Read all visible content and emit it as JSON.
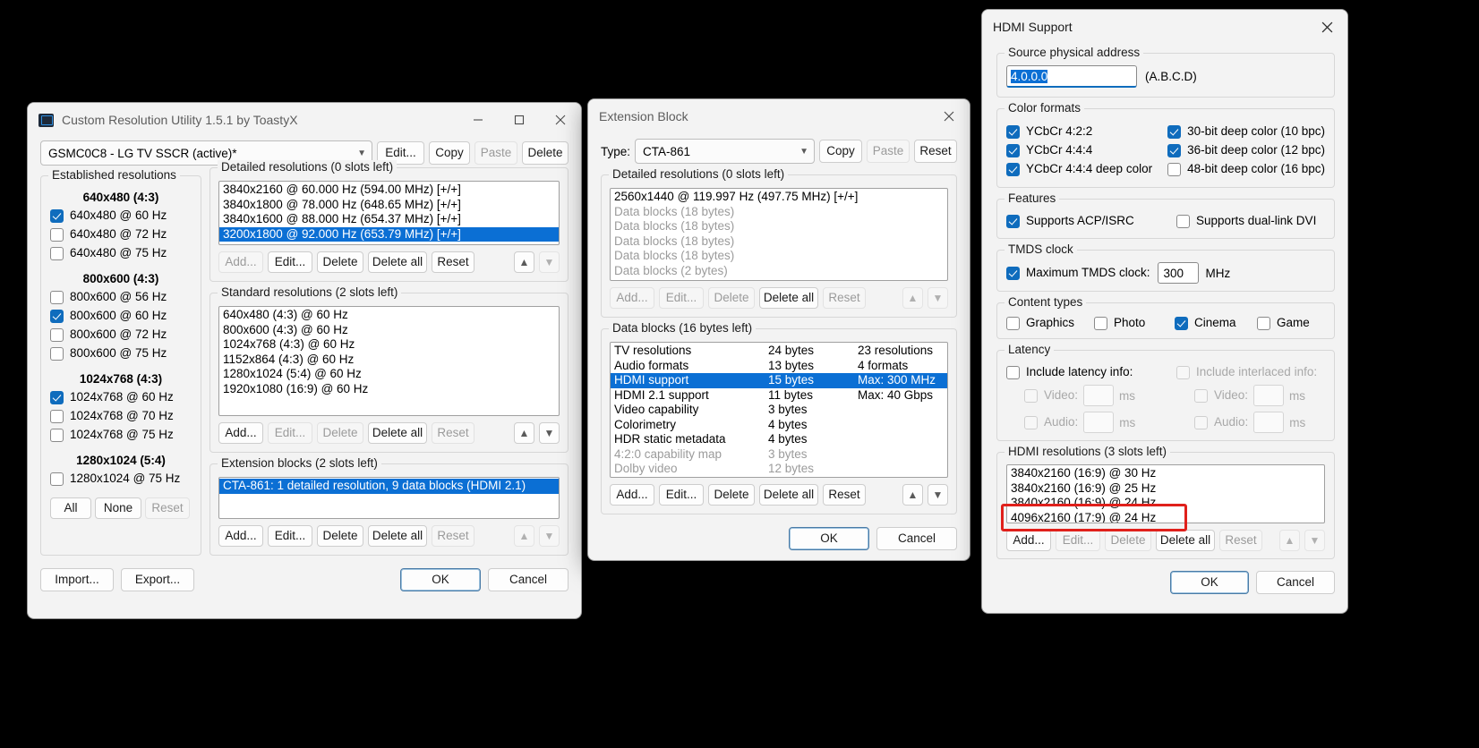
{
  "cru": {
    "title": "Custom Resolution Utility 1.5.1 by ToastyX",
    "icon": "monitor-icon",
    "minimize": "—",
    "maximize": "☐",
    "close": "✕",
    "display_select": "GSMC0C8 - LG TV SSCR (active)*",
    "top_buttons": [
      {
        "label": "Edit...",
        "enabled": true
      },
      {
        "label": "Copy",
        "enabled": true
      },
      {
        "label": "Paste",
        "enabled": false
      },
      {
        "label": "Delete",
        "enabled": true
      }
    ],
    "established": {
      "legend": "Established resolutions",
      "groups": [
        {
          "heading": "640x480 (4:3)",
          "items": [
            {
              "label": "640x480 @ 60 Hz",
              "checked": true
            },
            {
              "label": "640x480 @ 72 Hz",
              "checked": false
            },
            {
              "label": "640x480 @ 75 Hz",
              "checked": false
            }
          ]
        },
        {
          "heading": "800x600 (4:3)",
          "items": [
            {
              "label": "800x600 @ 56 Hz",
              "checked": false
            },
            {
              "label": "800x600 @ 60 Hz",
              "checked": true
            },
            {
              "label": "800x600 @ 72 Hz",
              "checked": false
            },
            {
              "label": "800x600 @ 75 Hz",
              "checked": false
            }
          ]
        },
        {
          "heading": "1024x768 (4:3)",
          "items": [
            {
              "label": "1024x768 @ 60 Hz",
              "checked": true
            },
            {
              "label": "1024x768 @ 70 Hz",
              "checked": false
            },
            {
              "label": "1024x768 @ 75 Hz",
              "checked": false
            }
          ]
        },
        {
          "heading": "1280x1024 (5:4)",
          "items": [
            {
              "label": "1280x1024 @ 75 Hz",
              "checked": false
            }
          ]
        }
      ],
      "buttons": [
        {
          "label": "All",
          "enabled": true
        },
        {
          "label": "None",
          "enabled": true
        },
        {
          "label": "Reset",
          "enabled": false
        }
      ]
    },
    "detailed": {
      "legend": "Detailed resolutions (0 slots left)",
      "rows": [
        {
          "text": "3840x2160 @ 60.000 Hz (594.00 MHz) [+/+]",
          "selected": false
        },
        {
          "text": "3840x1800 @ 78.000 Hz (648.65 MHz) [+/+]",
          "selected": false
        },
        {
          "text": "3840x1600 @ 88.000 Hz (654.37 MHz) [+/+]",
          "selected": false
        },
        {
          "text": "3200x1800 @ 92.000 Hz (653.79 MHz) [+/+]",
          "selected": true
        }
      ],
      "buttons": [
        {
          "label": "Add...",
          "enabled": false
        },
        {
          "label": "Edit...",
          "enabled": true
        },
        {
          "label": "Delete",
          "enabled": true
        },
        {
          "label": "Delete all",
          "enabled": true
        },
        {
          "label": "Reset",
          "enabled": true
        }
      ]
    },
    "standard": {
      "legend": "Standard resolutions (2 slots left)",
      "rows": [
        "640x480 (4:3) @ 60 Hz",
        "800x600 (4:3) @ 60 Hz",
        "1024x768 (4:3) @ 60 Hz",
        "1152x864 (4:3) @ 60 Hz",
        "1280x1024 (5:4) @ 60 Hz",
        "1920x1080 (16:9) @ 60 Hz"
      ],
      "buttons": [
        {
          "label": "Add...",
          "enabled": true
        },
        {
          "label": "Edit...",
          "enabled": false
        },
        {
          "label": "Delete",
          "enabled": false
        },
        {
          "label": "Delete all",
          "enabled": true
        },
        {
          "label": "Reset",
          "enabled": false
        }
      ]
    },
    "extension": {
      "legend": "Extension blocks (2 slots left)",
      "rows": [
        {
          "text": "CTA-861: 1 detailed resolution, 9 data blocks (HDMI 2.1)",
          "selected": true
        }
      ],
      "buttons": [
        {
          "label": "Add...",
          "enabled": true
        },
        {
          "label": "Edit...",
          "enabled": true
        },
        {
          "label": "Delete",
          "enabled": true
        },
        {
          "label": "Delete all",
          "enabled": true
        },
        {
          "label": "Reset",
          "enabled": false
        }
      ]
    },
    "footer": {
      "import": "Import...",
      "export": "Export...",
      "ok": "OK",
      "cancel": "Cancel"
    }
  },
  "extblock": {
    "title": "Extension Block",
    "close": "✕",
    "type_label": "Type:",
    "type_value": "CTA-861",
    "header_buttons": [
      {
        "label": "Copy",
        "enabled": true
      },
      {
        "label": "Paste",
        "enabled": false
      },
      {
        "label": "Reset",
        "enabled": true
      }
    ],
    "detailed": {
      "legend": "Detailed resolutions (0 slots left)",
      "rows": [
        {
          "text": "2560x1440 @ 119.997 Hz (497.75 MHz) [+/+]",
          "gray": false
        },
        {
          "text": "Data blocks (18 bytes)",
          "gray": true
        },
        {
          "text": "Data blocks (18 bytes)",
          "gray": true
        },
        {
          "text": "Data blocks (18 bytes)",
          "gray": true
        },
        {
          "text": "Data blocks (18 bytes)",
          "gray": true
        },
        {
          "text": "Data blocks (2 bytes)",
          "gray": true
        }
      ],
      "buttons": [
        {
          "label": "Add...",
          "enabled": false
        },
        {
          "label": "Edit...",
          "enabled": false
        },
        {
          "label": "Delete",
          "enabled": false
        },
        {
          "label": "Delete all",
          "enabled": true
        },
        {
          "label": "Reset",
          "enabled": false
        }
      ]
    },
    "datablocks": {
      "legend": "Data blocks (16 bytes left)",
      "rows": [
        {
          "name": "TV resolutions",
          "size": "24 bytes",
          "info": "23 resolutions",
          "gray": false,
          "selected": false
        },
        {
          "name": "Audio formats",
          "size": "13 bytes",
          "info": "4 formats",
          "gray": false,
          "selected": false
        },
        {
          "name": "HDMI support",
          "size": "15 bytes",
          "info": "Max: 300 MHz",
          "gray": false,
          "selected": true
        },
        {
          "name": "HDMI 2.1 support",
          "size": "11 bytes",
          "info": "Max: 40 Gbps",
          "gray": false,
          "selected": false
        },
        {
          "name": "Video capability",
          "size": "3 bytes",
          "info": "",
          "gray": false,
          "selected": false
        },
        {
          "name": "Colorimetry",
          "size": "4 bytes",
          "info": "",
          "gray": false,
          "selected": false
        },
        {
          "name": "HDR static metadata",
          "size": "4 bytes",
          "info": "",
          "gray": false,
          "selected": false
        },
        {
          "name": "4:2:0 capability map",
          "size": "3 bytes",
          "info": "",
          "gray": true,
          "selected": false
        },
        {
          "name": "Dolby video",
          "size": "12 bytes",
          "info": "",
          "gray": true,
          "selected": false
        }
      ],
      "buttons": [
        {
          "label": "Add...",
          "enabled": true
        },
        {
          "label": "Edit...",
          "enabled": true
        },
        {
          "label": "Delete",
          "enabled": true
        },
        {
          "label": "Delete all",
          "enabled": true
        },
        {
          "label": "Reset",
          "enabled": true
        }
      ]
    },
    "footer": {
      "ok": "OK",
      "cancel": "Cancel"
    }
  },
  "hdmi": {
    "title": "HDMI Support",
    "close": "✕",
    "spa": {
      "legend": "Source physical address",
      "value": "4.0.0.0",
      "hint": "(A.B.C.D)"
    },
    "color_formats": {
      "legend": "Color formats",
      "left": [
        {
          "label": "YCbCr 4:2:2",
          "checked": true
        },
        {
          "label": "YCbCr 4:4:4",
          "checked": true
        },
        {
          "label": "YCbCr 4:4:4 deep color",
          "checked": true
        }
      ],
      "right": [
        {
          "label": "30-bit deep color (10 bpc)",
          "checked": true
        },
        {
          "label": "36-bit deep color (12 bpc)",
          "checked": true
        },
        {
          "label": "48-bit deep color (16 bpc)",
          "checked": false
        }
      ]
    },
    "features": {
      "legend": "Features",
      "items": [
        {
          "label": "Supports ACP/ISRC",
          "checked": true
        },
        {
          "label": "Supports dual-link DVI",
          "checked": false
        }
      ]
    },
    "tmds": {
      "legend": "TMDS clock",
      "label": "Maximum TMDS clock:",
      "checked": true,
      "value": "300",
      "unit": "MHz"
    },
    "content_types": {
      "legend": "Content types",
      "items": [
        {
          "label": "Graphics",
          "checked": false
        },
        {
          "label": "Photo",
          "checked": false
        },
        {
          "label": "Cinema",
          "checked": true
        },
        {
          "label": "Game",
          "checked": false
        }
      ]
    },
    "latency": {
      "legend": "Latency",
      "include_latency": {
        "label": "Include latency info:",
        "checked": false,
        "enabled": true
      },
      "include_interlaced": {
        "label": "Include interlaced info:",
        "checked": false,
        "enabled": false
      },
      "left_rows": [
        {
          "label": "Video:",
          "value": "",
          "unit": "ms"
        },
        {
          "label": "Audio:",
          "value": "",
          "unit": "ms"
        }
      ],
      "right_rows": [
        {
          "label": "Video:",
          "value": "",
          "unit": "ms"
        },
        {
          "label": "Audio:",
          "value": "",
          "unit": "ms"
        }
      ]
    },
    "resolutions": {
      "legend": "HDMI resolutions (3 slots left)",
      "rows": [
        "3840x2160 (16:9) @ 30 Hz",
        "3840x2160 (16:9) @ 25 Hz",
        "3840x2160 (16:9) @ 24 Hz",
        "4096x2160 (17:9) @ 24 Hz"
      ],
      "highlight_color": "#e0201b",
      "buttons": [
        {
          "label": "Add...",
          "enabled": true
        },
        {
          "label": "Edit...",
          "enabled": false
        },
        {
          "label": "Delete",
          "enabled": false
        },
        {
          "label": "Delete all",
          "enabled": true
        },
        {
          "label": "Reset",
          "enabled": false
        }
      ]
    },
    "footer": {
      "ok": "OK",
      "cancel": "Cancel"
    }
  }
}
